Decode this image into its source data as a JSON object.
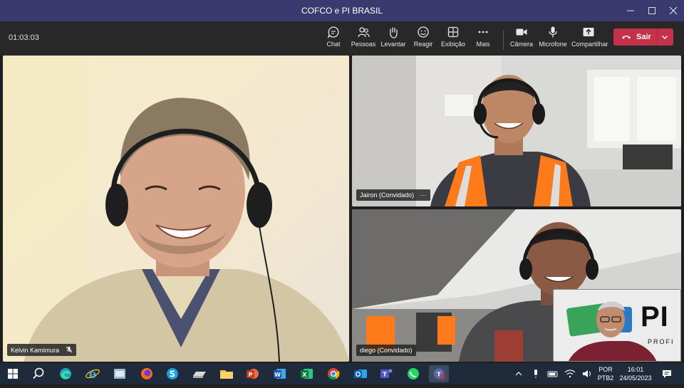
{
  "window": {
    "title": "COFCO e PI BRASIL",
    "controls": [
      "minimize-icon",
      "maximize-icon",
      "close-icon"
    ]
  },
  "toolbar": {
    "timer": "01:03:03",
    "buttons": [
      {
        "label": "Chat",
        "icon": "chat-icon"
      },
      {
        "label": "Pessoas",
        "icon": "people-icon"
      },
      {
        "label": "Levantar",
        "icon": "raise-hand-icon"
      },
      {
        "label": "Reagir",
        "icon": "smiley-icon"
      },
      {
        "label": "Exibição",
        "icon": "grid-view-icon"
      },
      {
        "label": "Mais",
        "icon": "more-icon"
      },
      {
        "label": "Câmera",
        "icon": "camera-icon"
      },
      {
        "label": "Microfone",
        "icon": "microphone-icon"
      },
      {
        "label": "Compartilhar",
        "icon": "share-icon"
      }
    ],
    "leave": {
      "label": "Sair",
      "color": "#c4314b"
    }
  },
  "participants": [
    {
      "name": "Kelvin Kamimura",
      "muted": true
    },
    {
      "name": "Jairon (Convidado)",
      "more": "···"
    },
    {
      "name": "diego (Convidado)"
    }
  ],
  "self_view": {
    "logo_text": "PI",
    "logo_sub": "PROFI"
  },
  "taskbar": {
    "apps": [
      "windows-start-icon",
      "search-icon",
      "edge-icon",
      "internet-explorer-icon",
      "file-manager-icon",
      "firefox-icon",
      "skype-icon",
      "drive-icon",
      "file-explorer-icon",
      "powerpoint-icon",
      "word-icon",
      "excel-icon",
      "chrome-icon",
      "outlook-icon",
      "teams-icon",
      "whatsapp-icon",
      "teams-active-icon"
    ],
    "tray": {
      "lang_top": "POR",
      "lang_bottom": "PTB2",
      "time": "16:01",
      "date": "24/05/2023"
    }
  },
  "colors": {
    "titlebar": "#3b3a70",
    "toolbar": "#292828",
    "leave": "#c4314b",
    "taskbar": "#1f2a3a"
  }
}
